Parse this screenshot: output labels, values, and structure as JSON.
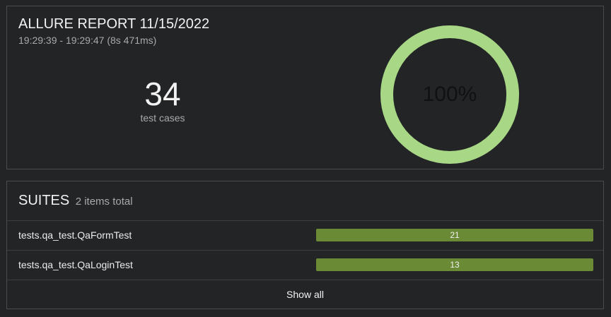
{
  "summary": {
    "title": "ALLURE REPORT 11/15/2022",
    "subtitle": "19:29:39 - 19:29:47 (8s 471ms)",
    "test_cases_count": "34",
    "test_cases_label": "test cases",
    "success_rate_text": "100%",
    "success_fraction": 1.0,
    "ring_color": "#a8d785"
  },
  "suites": {
    "title": "SUITES",
    "count_text": "2 items total",
    "bar_color": "#6b8a36",
    "items": [
      {
        "name": "tests.qa_test.QaFormTest",
        "count": "21"
      },
      {
        "name": "tests.qa_test.QaLoginTest",
        "count": "13"
      }
    ],
    "show_all_label": "Show all"
  }
}
